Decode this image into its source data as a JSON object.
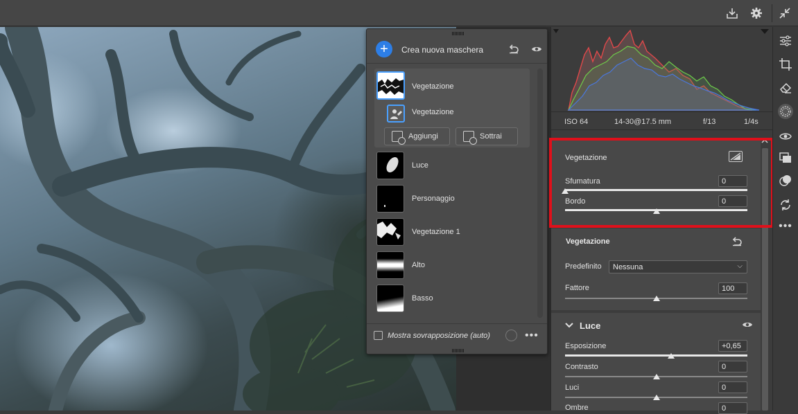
{
  "topbar": {
    "icons": [
      "download-icon",
      "gear-icon",
      "collapse-icon"
    ]
  },
  "mask_panel": {
    "title": "Crea nuova maschera",
    "group": {
      "name": "Vegetazione",
      "sub_name": "Vegetazione",
      "add_label": "Aggiungi",
      "subtract_label": "Sottrai"
    },
    "masks": [
      {
        "label": "Luce"
      },
      {
        "label": "Personaggio"
      },
      {
        "label": "Vegetazione 1"
      },
      {
        "label": "Alto"
      },
      {
        "label": "Basso"
      }
    ],
    "overlay_label": "Mostra sovrapposizione (auto)"
  },
  "exif": {
    "iso": "ISO 64",
    "lens": "14-30@17.5 mm",
    "aperture": "f/13",
    "shutter": "1/4s"
  },
  "component": {
    "title": "Vegetazione",
    "feather_label": "Sfumatura",
    "feather_value": "0",
    "feather_level": 0,
    "edge_label": "Bordo",
    "edge_value": "0",
    "edge_level": 0.5
  },
  "adjust": {
    "title": "Vegetazione",
    "preset_label": "Predefinito",
    "preset_value": "Nessuna",
    "amount_label": "Fattore",
    "amount_value": "100",
    "amount_level": 0.5
  },
  "light": {
    "title": "Luce",
    "sliders": [
      {
        "label": "Esposizione",
        "value": "+0,65",
        "level": 0.58
      },
      {
        "label": "Contrasto",
        "value": "0",
        "level": 0.5
      },
      {
        "label": "Luci",
        "value": "0",
        "level": 0.5
      },
      {
        "label": "Ombre",
        "value": "0",
        "level": 0.5
      }
    ]
  },
  "colors": {
    "accent": "#2d7ee6",
    "highlight": "#e0101b"
  }
}
